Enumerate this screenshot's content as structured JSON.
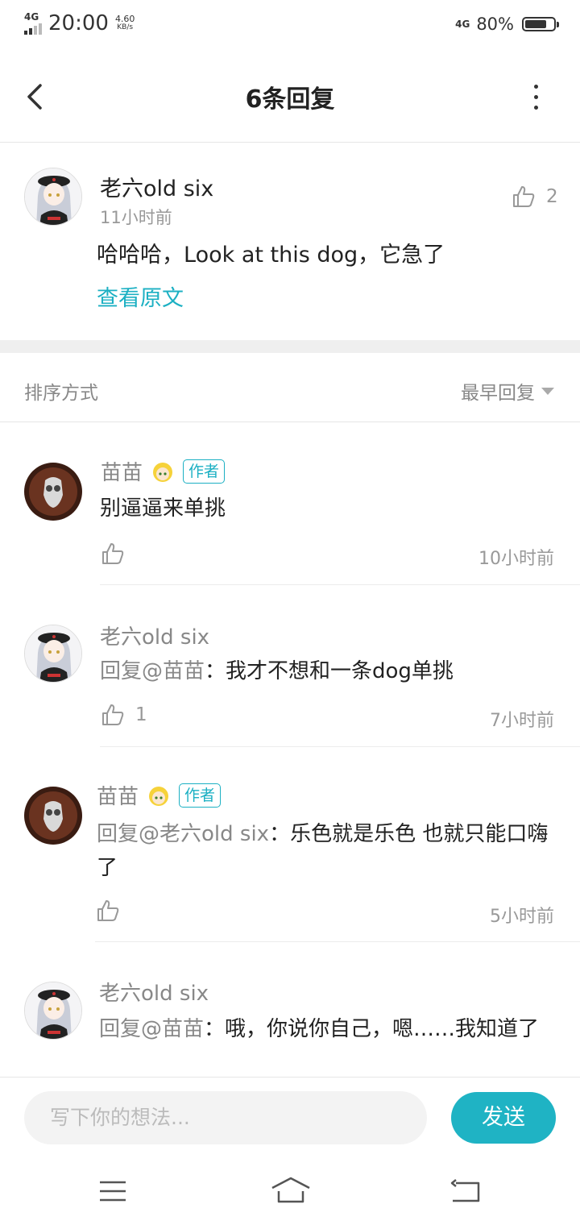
{
  "status_bar": {
    "network": "4G",
    "time": "20:00",
    "speed_value": "4.60",
    "speed_unit": "KB/s",
    "network_right": "4G",
    "battery_pct": "80%",
    "battery_level": 0.8
  },
  "header": {
    "title": "6条回复",
    "back_icon": "chevron-left-icon",
    "more_icon": "more-vertical-icon"
  },
  "main_comment": {
    "author": "老六old six",
    "time": "11小时前",
    "text": "哈哈哈，Look at this dog，它急了",
    "view_original": "查看原文",
    "like_count": "2"
  },
  "sort": {
    "label": "排序方式",
    "selected": "最早回复"
  },
  "replies": [
    {
      "author": "苗苗",
      "badge": "作者",
      "text": "别逼逼来单挑",
      "time": "10小时前",
      "likes": ""
    },
    {
      "author": "老六old six",
      "badge": "",
      "mention": "回复@苗苗",
      "text": "：我才不想和一条dog单挑",
      "time": "7小时前",
      "likes": "1"
    },
    {
      "author": "苗苗",
      "badge": "作者",
      "mention": "回复@老六old six",
      "text": "：乐色就是乐色 也就只能口嗨了",
      "time": "5小时前",
      "likes": ""
    },
    {
      "author": "老六old six",
      "badge": "",
      "mention": "回复@苗苗",
      "text": "：哦，你说你自己，嗯……我知道了",
      "time": "",
      "likes": ""
    }
  ],
  "composer": {
    "placeholder": "写下你的想法...",
    "send_label": "发送"
  },
  "nav": [
    "menu-icon",
    "home-icon",
    "back-icon"
  ],
  "colors": {
    "accent": "#1cb0c3",
    "send_bg": "#1fb3c4"
  }
}
